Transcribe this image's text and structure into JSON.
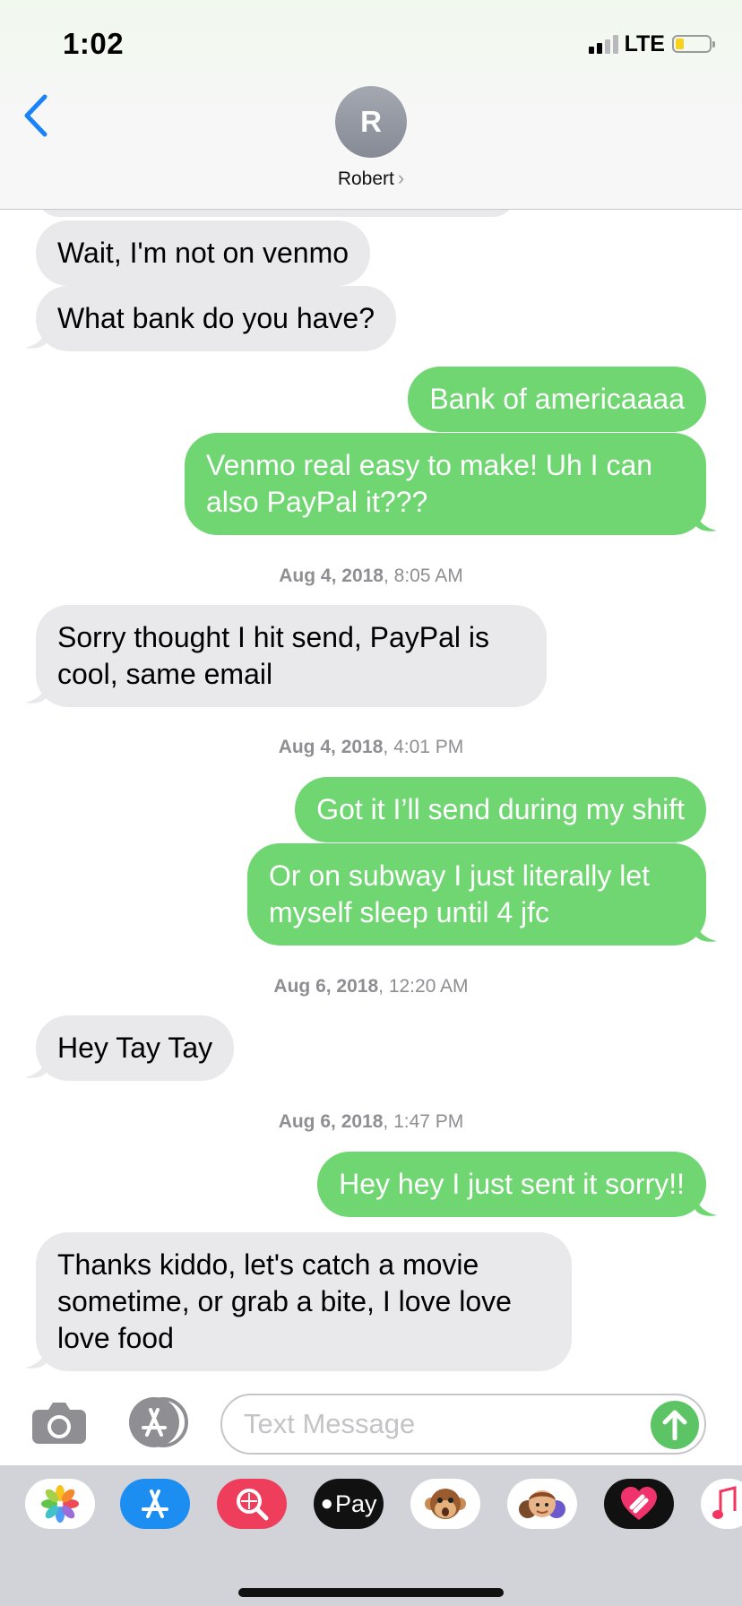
{
  "status_bar": {
    "time": "1:02",
    "network": "LTE",
    "battery_level": 0.25
  },
  "header": {
    "avatar_initial": "R",
    "contact_name": "Robert"
  },
  "messages": {
    "m1": "Wait, I'm not on venmo",
    "m2": "What bank do you have?",
    "m3": "Bank of americaaaa",
    "m4": "Venmo real easy to make! Uh I can also PayPal it???",
    "ts1_date": "Aug 4, 2018",
    "ts1_time": ", 8:05 AM",
    "m5": "Sorry thought I hit send, PayPal is cool, same email",
    "ts2_date": "Aug 4, 2018",
    "ts2_time": ", 4:01 PM",
    "m6": "Got it I’ll send during my shift",
    "m7": "Or on subway I just literally let myself sleep until 4 jfc",
    "ts3_date": "Aug 6, 2018",
    "ts3_time": ", 12:20 AM",
    "m8": "Hey Tay Tay",
    "ts4_date": "Aug 6, 2018",
    "ts4_time": ", 1:47 PM",
    "m9": "Hey hey I just sent it sorry!!",
    "m10": "Thanks kiddo, let's catch a movie sometime, or grab a bite, I love love love food"
  },
  "composer": {
    "placeholder": "Text Message"
  },
  "app_drawer": {
    "apple_pay_label": "Pay",
    "icons": [
      "photos-icon",
      "app-store-icon",
      "image-search-icon",
      "apple-pay-icon",
      "monkey-animoji-icon",
      "memoji-icon",
      "digital-touch-icon",
      "music-icon"
    ]
  },
  "colors": {
    "outgoing_bubble": "#6fd672",
    "incoming_bubble": "#e9e9eb",
    "accent": "#1a82fb"
  }
}
